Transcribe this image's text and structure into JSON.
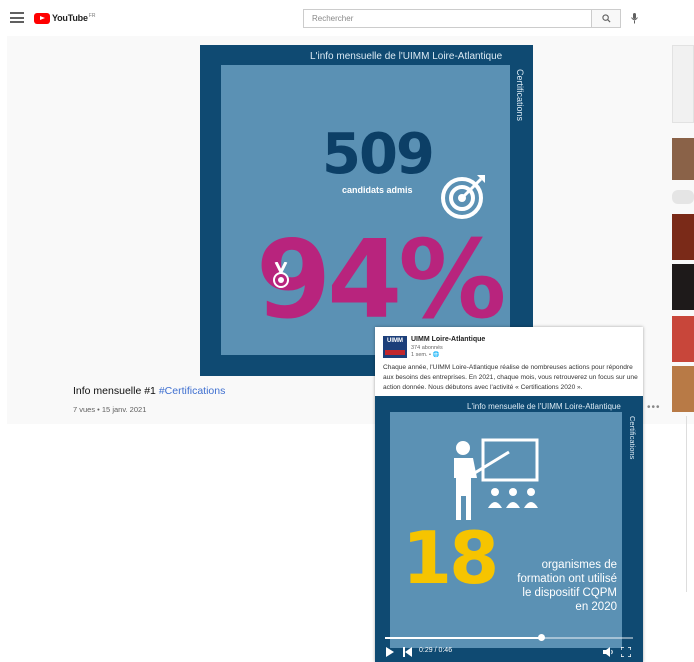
{
  "header": {
    "logo_text": "YouTube",
    "logo_region": "FR",
    "search_placeholder": "Rechercher"
  },
  "video": {
    "headline": "L'info mensuelle de l'UIMM Loire-Atlantique",
    "side_label": "Certifications",
    "big_number": "509",
    "big_number_caption": "candidats admis",
    "percent": "94%",
    "title_prefix": "Info mensuelle #1",
    "title_hashtag": "#Certifications",
    "meta": "7 vues • 15 janv. 2021"
  },
  "post": {
    "org_logo": "UIMM",
    "org_name": "UIMM Loire-Atlantique",
    "followers": "374 abonnés",
    "time": "1 sem. •",
    "text": "Chaque année, l'UIMM Loire-Atlantique réalise de nombreuses actions pour répondre aux besoins des entreprises. En 2021, chaque mois, vous retrouverez un focus sur une action donnée. Nous débutons avec l'activité « Certifications 2020 ».",
    "media": {
      "headline": "L'info mensuelle de l'UIMM Loire-Atlantique",
      "side_label": "Certifications",
      "big_number": "18",
      "caption": "organismes de formation ont utilisé le dispositif CQPM en 2020",
      "time": "0:29 / 0:46",
      "progress": 0.63
    }
  },
  "colors": {
    "brand_red": "#ff0000",
    "frame_blue": "#0f4a72",
    "card_blue": "#5b91b4",
    "magenta": "#b8247d",
    "yellow": "#f6c400"
  }
}
